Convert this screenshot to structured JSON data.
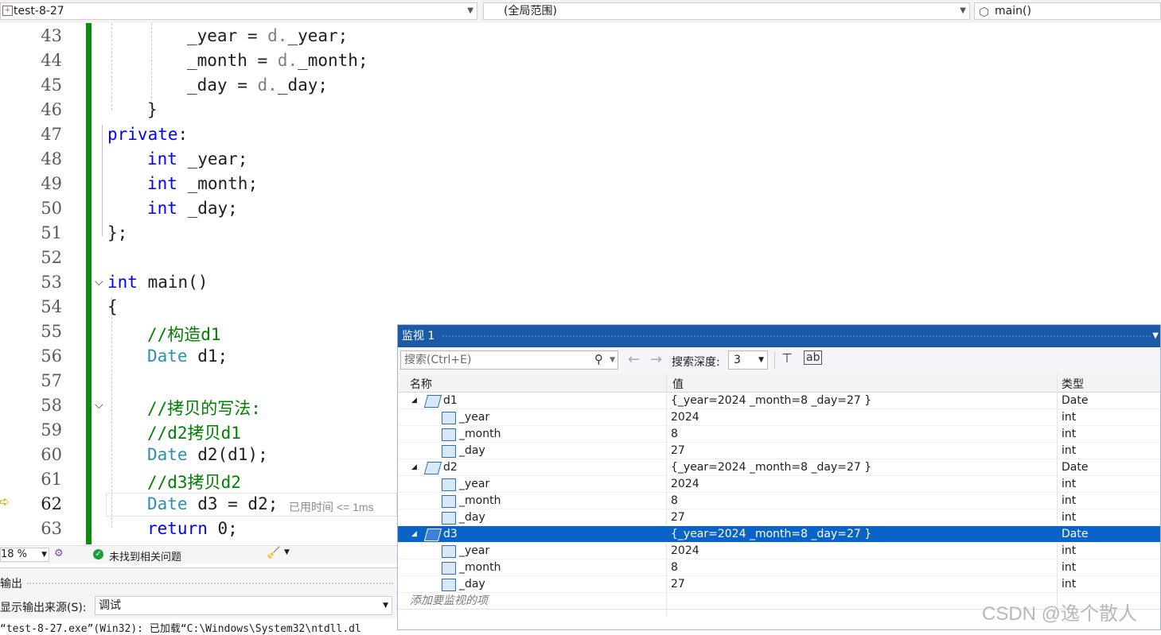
{
  "navbar": {
    "project": "test-8-27",
    "scope": "(全局范围)",
    "function": "main()"
  },
  "editor": {
    "lines": [
      {
        "num": "43"
      },
      {
        "num": "44"
      },
      {
        "num": "45"
      },
      {
        "num": "46"
      },
      {
        "num": "47"
      },
      {
        "num": "48"
      },
      {
        "num": "49"
      },
      {
        "num": "50"
      },
      {
        "num": "51"
      },
      {
        "num": "52"
      },
      {
        "num": "53"
      },
      {
        "num": "54"
      },
      {
        "num": "55"
      },
      {
        "num": "56"
      },
      {
        "num": "57"
      },
      {
        "num": "58"
      },
      {
        "num": "59"
      },
      {
        "num": "60"
      },
      {
        "num": "61"
      },
      {
        "num": "62"
      },
      {
        "num": "63"
      }
    ],
    "code": {
      "l43_var": "_year",
      "l43_eq": " = ",
      "l43_obj": "d.",
      "l43_mem": "_year;",
      "l44_var": "_month",
      "l44_eq": " = ",
      "l44_obj": "d.",
      "l44_mem": "_month;",
      "l45_var": "_day",
      "l45_eq": " = ",
      "l45_obj": "d.",
      "l45_mem": "_day;",
      "l46": "}",
      "l47_kw": "private",
      "l47_colon": ":",
      "l48_kw": "int",
      "l48_rest": " _year;",
      "l49_kw": "int",
      "l49_rest": " _month;",
      "l50_kw": "int",
      "l50_rest": " _day;",
      "l51": "};",
      "l53_kw": "int",
      "l53_rest": " main()",
      "l54": "{",
      "l55": "//构造d1",
      "l56_ty": "Date",
      "l56_rest": " d1;",
      "l58": "//拷贝的写法:",
      "l59": "//d2拷贝d1",
      "l60_ty": "Date",
      "l60_rest": " d2(d1);",
      "l61": "//d3拷贝d2",
      "l62_ty": "Date",
      "l62_rest": " d3 = d2;",
      "l62_hint": "已用时间 <= 1ms",
      "l63_kw": "return",
      "l63_rest": " 0;"
    }
  },
  "status": {
    "zoom": "18 %",
    "issues": "未找到相关问题"
  },
  "output": {
    "title": "输出",
    "source_label": "显示输出来源(S):",
    "source_value": "调试",
    "log_line": "“test-8-27.exe”(Win32): 已加载“C:\\Windows\\System32\\ntdll.dl"
  },
  "watch": {
    "title": "监视 1",
    "search_placeholder": "搜索(Ctrl+E)",
    "depth_label": "搜索深度:",
    "depth_value": "3",
    "columns": {
      "name": "名称",
      "value": "值",
      "type": "类型"
    },
    "rows": [
      {
        "name": "d1",
        "value": "{_year=2024 _month=8 _day=27 }",
        "type": "Date"
      },
      {
        "name": "_year",
        "value": "2024",
        "type": "int"
      },
      {
        "name": "_month",
        "value": "8",
        "type": "int"
      },
      {
        "name": "_day",
        "value": "27",
        "type": "int"
      },
      {
        "name": "d2",
        "value": "{_year=2024 _month=8 _day=27 }",
        "type": "Date"
      },
      {
        "name": "_year",
        "value": "2024",
        "type": "int"
      },
      {
        "name": "_month",
        "value": "8",
        "type": "int"
      },
      {
        "name": "_day",
        "value": "27",
        "type": "int"
      },
      {
        "name": "d3",
        "value": "{_year=2024 _month=8 _day=27 }",
        "type": "Date"
      },
      {
        "name": "_year",
        "value": "2024",
        "type": "int"
      },
      {
        "name": "_month",
        "value": "8",
        "type": "int"
      },
      {
        "name": "_day",
        "value": "27",
        "type": "int"
      }
    ],
    "add_item": "添加要监视的项"
  },
  "watermark": "CSDN @逸个散人"
}
